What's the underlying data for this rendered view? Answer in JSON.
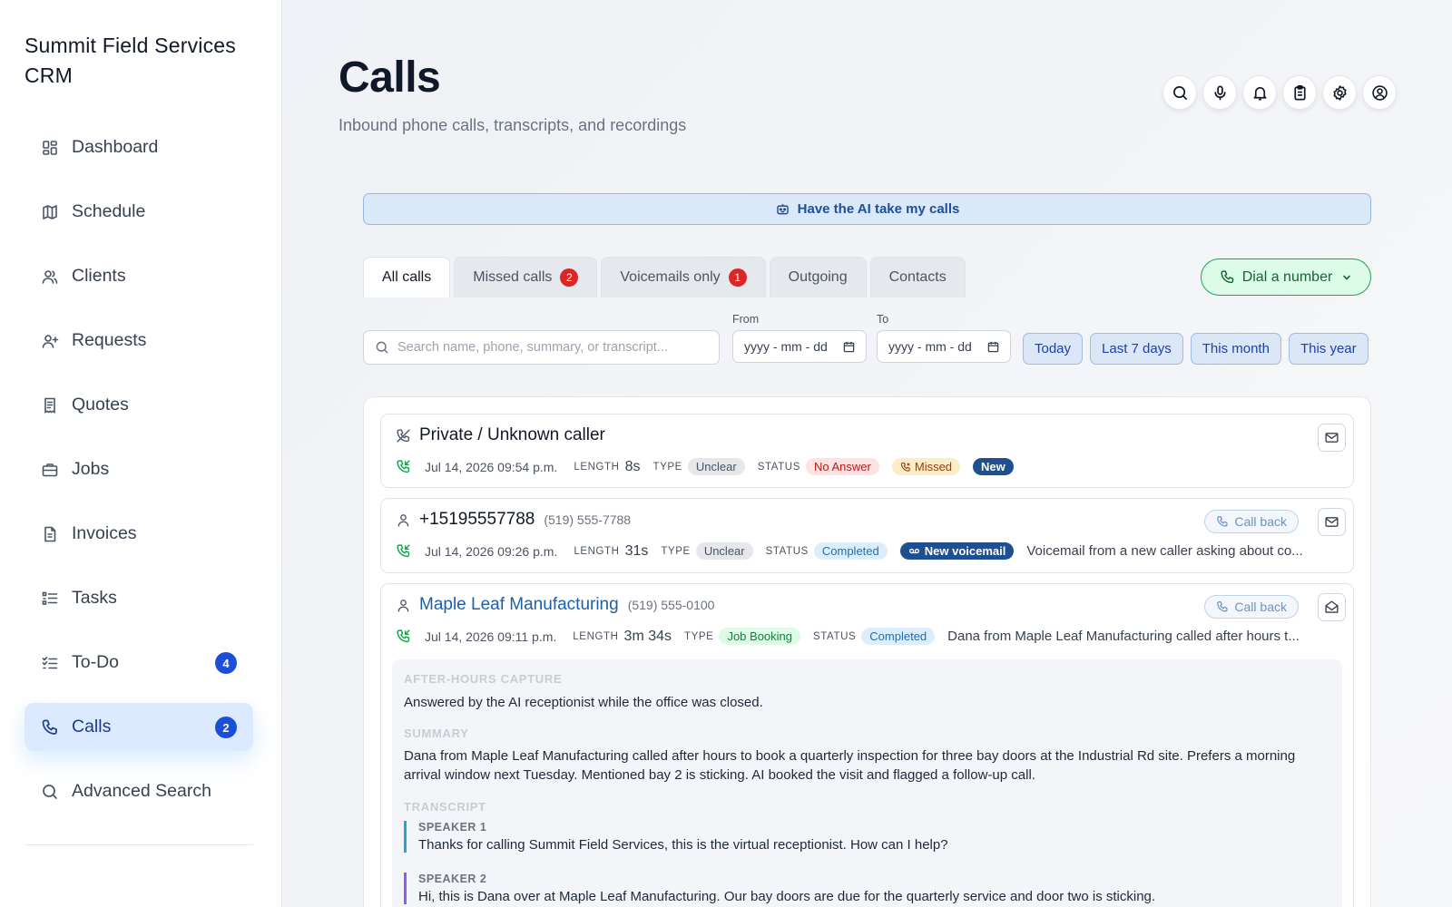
{
  "brand": "Summit Field Services CRM",
  "nav": [
    {
      "label": "Dashboard",
      "icon": "dashboard-icon"
    },
    {
      "label": "Schedule",
      "icon": "map-icon"
    },
    {
      "label": "Clients",
      "icon": "users-icon"
    },
    {
      "label": "Requests",
      "icon": "user-plus-icon"
    },
    {
      "label": "Quotes",
      "icon": "receipt-icon"
    },
    {
      "label": "Jobs",
      "icon": "briefcase-icon"
    },
    {
      "label": "Invoices",
      "icon": "file-icon"
    },
    {
      "label": "Tasks",
      "icon": "list-icon"
    },
    {
      "label": "To-Do",
      "icon": "checklist-icon",
      "badge": "4"
    },
    {
      "label": "Calls",
      "icon": "phone-icon",
      "badge": "2",
      "active": true
    },
    {
      "label": "Advanced Search",
      "icon": "search-icon"
    }
  ],
  "header": {
    "title": "Calls",
    "subtitle": "Inbound phone calls, transcripts, and recordings"
  },
  "ai_banner": "Have the AI take my calls",
  "tabs": [
    {
      "label": "All calls",
      "active": true
    },
    {
      "label": "Missed calls",
      "badge": "2"
    },
    {
      "label": "Voicemails only",
      "badge": "1"
    },
    {
      "label": "Outgoing"
    },
    {
      "label": "Contacts"
    }
  ],
  "dial_button": "Dial a number",
  "filters": {
    "search_placeholder": "Search name, phone, summary, or transcript...",
    "from_label": "From",
    "to_label": "To",
    "date_placeholder": "yyyy - mm - dd",
    "quick": [
      "Today",
      "Last 7 days",
      "This month",
      "This year"
    ]
  },
  "meta_labels": {
    "length": "LENGTH",
    "type": "TYPE",
    "status": "STATUS"
  },
  "calls": [
    {
      "name": "Private / Unknown caller",
      "date": "Jul 14, 2026 09:54 p.m.",
      "length": "8s",
      "type": "Unclear",
      "status": "No Answer",
      "tag_missed": "Missed",
      "tag_new": "New"
    },
    {
      "name": "+15195557788",
      "phone": "(519) 555-7788",
      "date": "Jul 14, 2026 09:26 p.m.",
      "length": "31s",
      "type": "Unclear",
      "status": "Completed",
      "tag": "New voicemail",
      "summary": "Voicemail from a new caller asking about co...",
      "callback": "Call back"
    },
    {
      "name": "Maple Leaf Manufacturing",
      "phone": "(519) 555-0100",
      "date": "Jul 14, 2026 09:11 p.m.",
      "length": "3m 34s",
      "type": "Job Booking",
      "status": "Completed",
      "summary": "Dana from Maple Leaf Manufacturing called after hours t...",
      "callback": "Call back",
      "details": {
        "capture_head": "AFTER-HOURS CAPTURE",
        "capture_text": "Answered by the AI receptionist while the office was closed.",
        "summary_head": "SUMMARY",
        "summary_text": "Dana from Maple Leaf Manufacturing called after hours to book a quarterly inspection for three bay doors at the Industrial Rd site. Prefers a morning arrival window next Tuesday. Mentioned bay 2 is sticking. AI booked the visit and flagged a follow-up call.",
        "transcript_head": "TRANSCRIPT",
        "transcript": [
          {
            "speaker": "SPEAKER 1",
            "text": "Thanks for calling Summit Field Services, this is the virtual receptionist. How can I help?"
          },
          {
            "speaker": "SPEAKER 2",
            "text": "Hi, this is Dana over at Maple Leaf Manufacturing. Our bay doors are due for the quarterly service and door two is sticking."
          }
        ]
      }
    }
  ]
}
